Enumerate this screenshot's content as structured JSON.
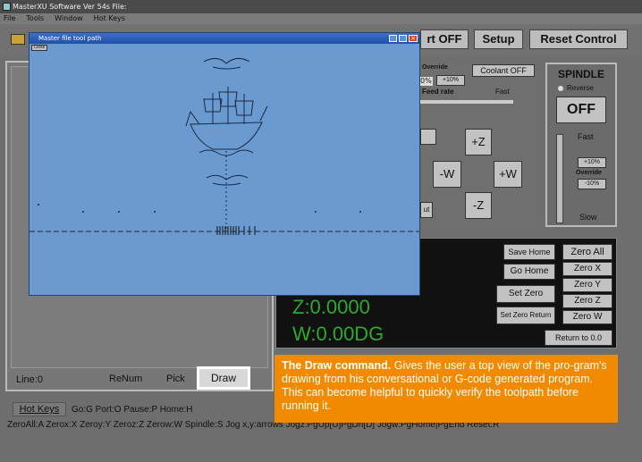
{
  "window": {
    "title": "MasterXU Software Ver 54s File:"
  },
  "menu": [
    "File",
    "Tools",
    "Window",
    "Hot Keys"
  ],
  "toolbar": {
    "start_off": "rt OFF",
    "setup": "Setup",
    "reset_control": "Reset Control"
  },
  "feed": {
    "override_label": "Override",
    "override_value": "+10%",
    "pct": "0%",
    "feedrate_label": "Feed rate",
    "fast_label": "Fast"
  },
  "coolant": {
    "label": "Coolant OFF"
  },
  "jog": {
    "plus_z": "+Z",
    "minus_w": "-W",
    "plus_w": "+W",
    "minus_z": "-Z",
    "partial_right1": "",
    "partial_right2": "ut"
  },
  "spindle": {
    "title": "SPINDLE",
    "reverse": "Reverse",
    "off": "OFF",
    "fast": "Fast",
    "plus10": "+10%",
    "override": "Override",
    "minus10": "-10%",
    "slow": "Slow"
  },
  "zero": {
    "save_home": "Save Home",
    "go_home": "Go Home",
    "set_zero": "Set Zero",
    "set_zero_return": "Set Zero Return",
    "zero_all": "Zero All",
    "zero_x": "Zero X",
    "zero_y": "Zero Y",
    "zero_z": "Zero Z",
    "zero_w": "Zero W",
    "return_to": "Return to 0.0"
  },
  "dro": {
    "z": "Z:0.0000",
    "w": "W:0.00DG"
  },
  "gcode": {
    "line": "Line:0",
    "renum": "ReNum",
    "pick": "Pick",
    "draw": "Draw"
  },
  "hotkeys": {
    "button": "Hot Keys",
    "line1": "Go:G  Port:O  Pause:P  Home:H",
    "line2": "ZeroAll:A  Zerox:X  Zeroy:Y  Zeroz:Z  Zerow:W  Spindle:S  Jog x,y:arrows  Jogz:PgUp[U]PgDn[D]  Jogw:PgHome|PgEnd  Reset:R"
  },
  "child": {
    "title": "Master file tool path",
    "close": "Close"
  },
  "callout": {
    "bold": "The Draw command.",
    "text": " Gives the user a top view of the pro-gram's drawing from his conversational or G-code generated program. This can become helpful to quickly verify the toolpath before running it."
  }
}
